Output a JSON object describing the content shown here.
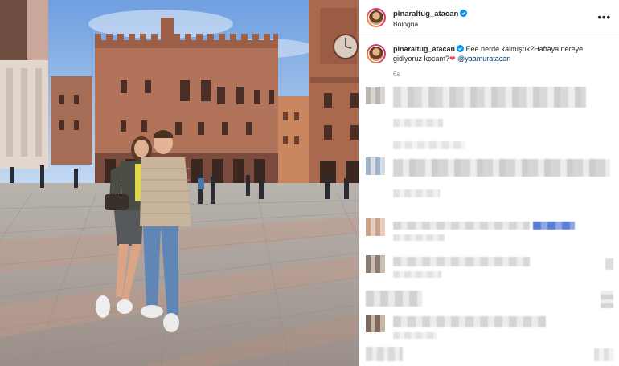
{
  "post": {
    "username": "pinaraltug_atacan",
    "location": "Bologna",
    "more_icon": "more-horizontal-icon"
  },
  "caption": {
    "username": "pinaraltug_atacan",
    "text": "Eee nerde kalmıştık?Haftaya nereye gidiyoruz kocam?",
    "emoji": "❤",
    "mention": "@yaamuratacan",
    "time": "6s"
  },
  "colors": {
    "verified": "#0095f6",
    "link": "#00376b",
    "heart": "#ed4956",
    "secondary_text": "#8e8e8e",
    "blurred_link": "#5b7fd6"
  },
  "comments_blurred": true
}
